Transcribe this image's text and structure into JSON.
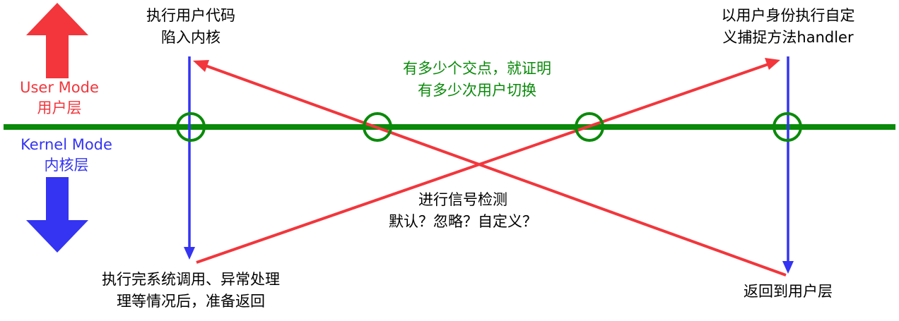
{
  "colors": {
    "user_mode": "#f2363c",
    "kernel_mode": "#3434f2",
    "boundary": "#0a8a0a",
    "transition": "#f2363c",
    "annotation": "#0a8a0a",
    "text": "#000000"
  },
  "legend": {
    "user_mode_en": "User Mode",
    "user_mode_zh": "用户层",
    "kernel_mode_en": "Kernel Mode",
    "kernel_mode_zh": "内核层",
    "up_arrow_icon": "arrow-up-icon",
    "down_arrow_icon": "arrow-down-icon"
  },
  "steps": {
    "trap": {
      "line1": "执行用户代码",
      "line2": "陷入内核"
    },
    "handled": {
      "line1": "执行完系统调用、异常处理",
      "line2": "理等情况后，准备返回"
    },
    "signal_check": {
      "line1": "进行信号检测",
      "line2": "默认？忽略？自定义？"
    },
    "user_handler": {
      "line1": "以用户身份执行自定",
      "line2": "义捕捉方法handler"
    },
    "return_user": {
      "line1": "返回到用户层"
    }
  },
  "note": {
    "line1": "有多少个交点，就证明",
    "line2": "有多少次用户切换"
  },
  "crossing_count": 4
}
